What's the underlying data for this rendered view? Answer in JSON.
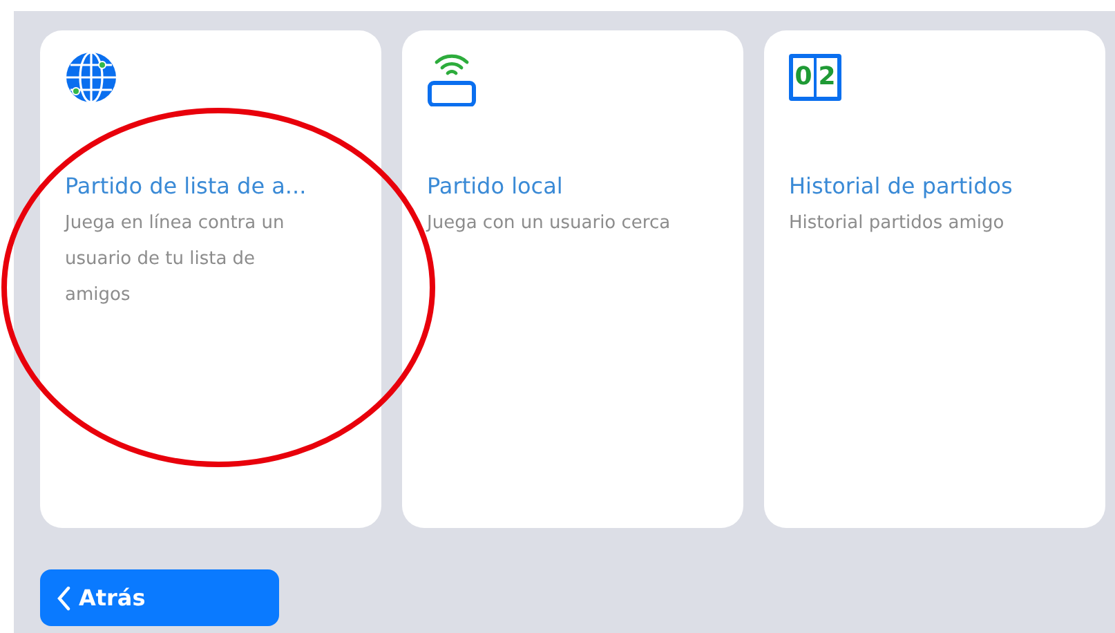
{
  "cards": [
    {
      "kind": "globe",
      "title": "Partido de lista de a...",
      "description": "Juega en línea contra un usuario de tu lista de amigos"
    },
    {
      "kind": "nearby",
      "title": "Partido local",
      "description": "Juega con un usuario cerca"
    },
    {
      "kind": "scoreboard",
      "title": "Historial de partidos",
      "description": "Historial partidos amigo",
      "score": [
        "0",
        "2"
      ]
    }
  ],
  "back_button": {
    "label": "Atrás"
  },
  "annotations": [
    {
      "kind": "circle",
      "color": "#e8000b"
    }
  ]
}
